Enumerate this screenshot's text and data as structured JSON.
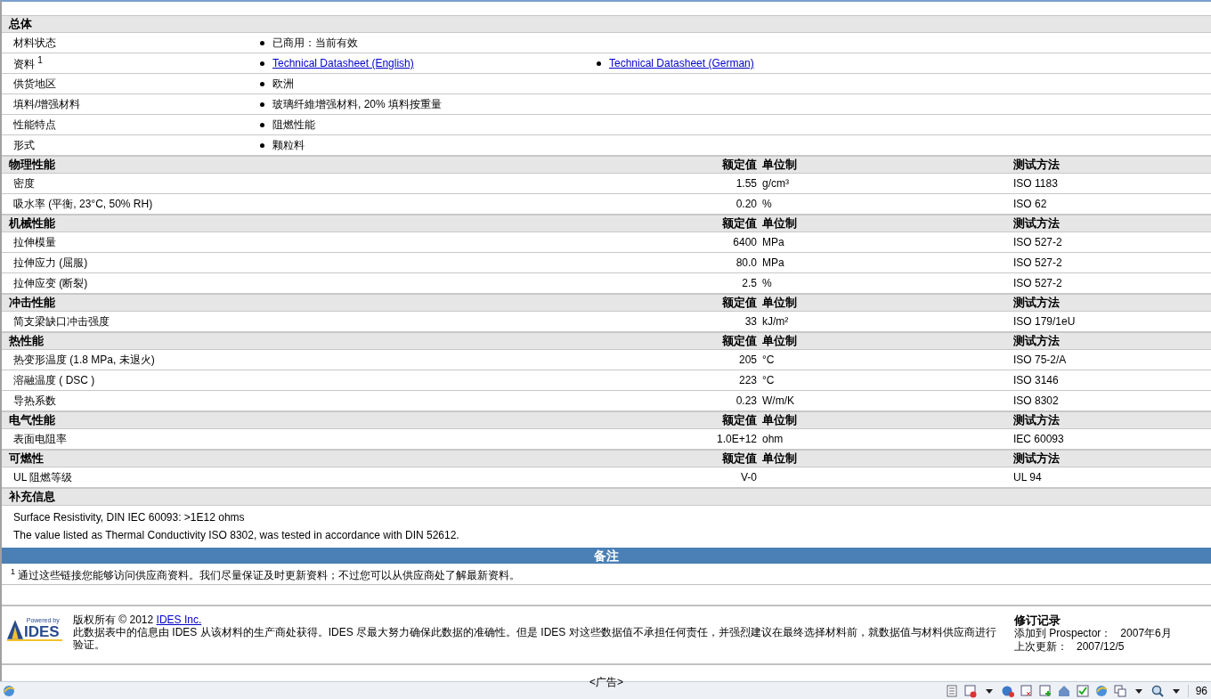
{
  "general": {
    "title": "总体",
    "rows": [
      {
        "label": "材料状态",
        "values": [
          {
            "kind": "text",
            "text": "已商用：当前有效"
          }
        ]
      },
      {
        "label": "资料 $^{1}$",
        "values": [
          {
            "kind": "link",
            "text": "Technical Datasheet (English)"
          },
          {
            "kind": "link",
            "text": "Technical Datasheet (German)"
          }
        ]
      },
      {
        "label": "供货地区",
        "values": [
          {
            "kind": "text",
            "text": "欧洲"
          }
        ]
      },
      {
        "label": "填料/增强材料",
        "values": [
          {
            "kind": "text",
            "text": "玻璃纤維增强材料, 20% 填料按重量"
          }
        ]
      },
      {
        "label": "性能特点",
        "values": [
          {
            "kind": "text",
            "text": "阻燃性能"
          }
        ]
      },
      {
        "label": "形式",
        "values": [
          {
            "kind": "text",
            "text": "颗粒料"
          }
        ]
      }
    ]
  },
  "property_sections": [
    {
      "title": "物理性能",
      "column_headers": [
        "额定值",
        "单位制",
        "测试方法"
      ],
      "rows": [
        {
          "property": "密度",
          "value": "1.55",
          "unit": "g/cm³",
          "test_method": "ISO 1183"
        },
        {
          "property": "吸水率 (平衡, 23°C, 50% RH)",
          "value": "0.20",
          "unit": "%",
          "test_method": "ISO 62"
        }
      ]
    },
    {
      "title": "机械性能",
      "column_headers": [
        "额定值",
        "单位制",
        "测试方法"
      ],
      "rows": [
        {
          "property": "拉伸模量",
          "value": "6400",
          "unit": "MPa",
          "test_method": "ISO 527-2"
        },
        {
          "property": "拉伸应力 (屈服)",
          "value": "80.0",
          "unit": "MPa",
          "test_method": "ISO 527-2"
        },
        {
          "property": "拉伸应变 (断裂)",
          "value": "2.5",
          "unit": "%",
          "test_method": "ISO 527-2"
        }
      ]
    },
    {
      "title": "冲击性能",
      "column_headers": [
        "额定值",
        "单位制",
        "测试方法"
      ],
      "rows": [
        {
          "property": "简支梁缺口冲击强度",
          "value": "33",
          "unit": "kJ/m²",
          "test_method": "ISO 179/1eU"
        }
      ]
    },
    {
      "title": "热性能",
      "column_headers": [
        "额定值",
        "单位制",
        "测试方法"
      ],
      "rows": [
        {
          "property": "热变形温度 (1.8 MPa, 未退火)",
          "value": "205",
          "unit": "°C",
          "test_method": "ISO 75-2/A"
        },
        {
          "property": "溶融温度 ( DSC )",
          "value": "223",
          "unit": "°C",
          "test_method": "ISO 3146"
        },
        {
          "property": "导热系数",
          "value": "0.23",
          "unit": "W/m/K",
          "test_method": "ISO 8302"
        }
      ]
    },
    {
      "title": "电气性能",
      "column_headers": [
        "额定值",
        "单位制",
        "测试方法"
      ],
      "rows": [
        {
          "property": "表面电阻率",
          "value": "1.0E+12",
          "unit": "ohm",
          "test_method": "IEC 60093"
        }
      ]
    },
    {
      "title": "可燃性",
      "column_headers": [
        "额定值",
        "单位制",
        "测试方法"
      ],
      "rows": [
        {
          "property": "UL 阻燃等级",
          "value": "V-0",
          "unit": "",
          "test_method": "UL 94"
        }
      ]
    }
  ],
  "supplementary": {
    "title": "补充信息",
    "notes": [
      "Surface Resistivity, DIN IEC 60093: >1E12 ohms",
      "The value listed as Thermal Conductivity ISO 8302, was tested in accordance with DIN 52612."
    ]
  },
  "remarks": {
    "title": "备注",
    "footnotes": [
      "$^{1}$ 通过这些链接您能够访问供应商资料。我们尽量保证及时更新资料；不过您可以从供应商处了解最新资料。"
    ]
  },
  "footer": {
    "logo_caption": "Powered by",
    "logo_text": "IDES",
    "copyright": "版权所有  © 2012 ",
    "copyright_link": "IDES Inc.",
    "disclaimer": "此数据表中的信息由  IDES 从该材料的生产商处获得。IDES 尽最大努力确保此数据的准确性。但是  IDES 对这些数据值不承担任何责任，并强烈建议在最终选择材料前，就数据值与材料供应商进行验证。",
    "revision": {
      "title": "修订记录",
      "added_label": "添加到  Prospector：",
      "added_value": "2007年6月",
      "updated_label": "上次更新：",
      "updated_value": "2007/12/5"
    }
  },
  "advertisement": "<广告>",
  "status_bar": {
    "zoom": "96"
  }
}
